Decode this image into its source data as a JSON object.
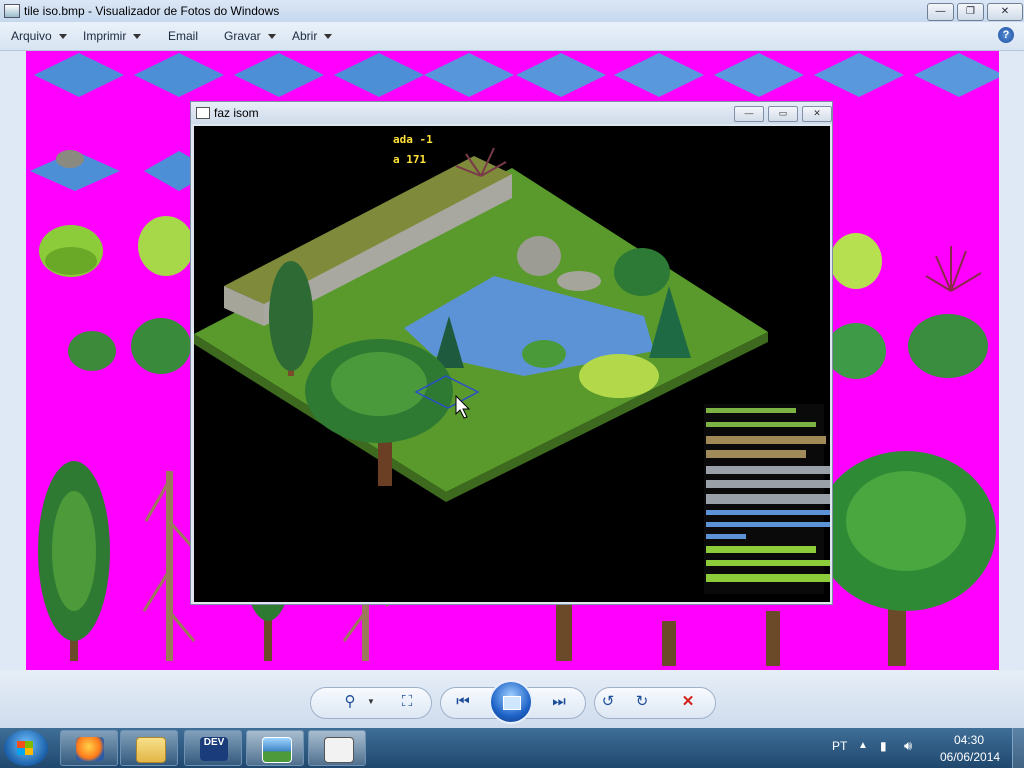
{
  "window": {
    "title": "tile iso.bmp - Visualizador de Fotos do Windows",
    "min_glyph": "—",
    "max_glyph": "❐",
    "close_glyph": "✕"
  },
  "menu": {
    "items": [
      {
        "label": "Arquivo"
      },
      {
        "label": "Imprimir"
      },
      {
        "label": "Email"
      },
      {
        "label": "Gravar"
      },
      {
        "label": "Abrir"
      }
    ],
    "help": "?"
  },
  "inner_window": {
    "title": "faz isom",
    "min_glyph": "—",
    "max_glyph": "▭",
    "close_glyph": "✕",
    "hud_line1": "ada -1",
    "hud_line2": "a 171"
  },
  "viewer_controls": {
    "zoom_icon": "⚲",
    "fit_icon": "⛶",
    "prev_icon": "⏮",
    "next_icon": "⏭",
    "rotate_left_icon": "↺",
    "rotate_right_icon": "↻",
    "delete_icon": "✕"
  },
  "taskbar": {
    "language": "PT",
    "time": "04:30",
    "date": "06/06/2014",
    "dev_label": "DEV"
  },
  "colors": {
    "sheet_background": "#ff00ff",
    "hud_text": "#ffe23a",
    "delete_red": "#d0201a"
  }
}
